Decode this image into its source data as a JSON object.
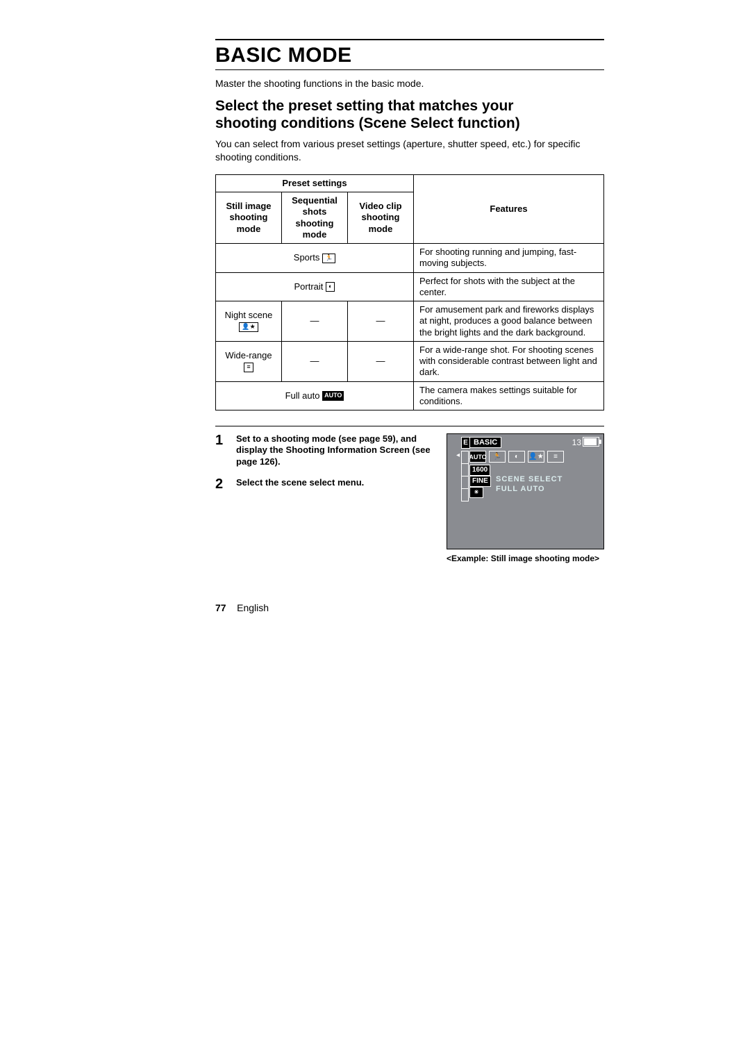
{
  "title": "BASIC MODE",
  "intro": "Master the shooting functions in the basic mode.",
  "section_title_l1": "Select the preset setting that matches your",
  "section_title_l2": "shooting conditions (Scene Select function)",
  "section_desc": "You can select from various preset settings (aperture, shutter speed, etc.) for specific shooting conditions.",
  "table": {
    "preset_head": "Preset settings",
    "col_still": "Still image shooting mode",
    "col_seq": "Sequential shots shooting mode",
    "col_video": "Video clip shooting mode",
    "col_features": "Features",
    "rows": {
      "sports": {
        "label": "Sports",
        "icon_text": "🏃",
        "span": 3,
        "feat": "For shooting running and jumping, fast-moving subjects."
      },
      "portrait": {
        "label": "Portrait",
        "icon_text": "◐",
        "span": 3,
        "feat": "Perfect for shots with the subject at the center."
      },
      "night": {
        "label": "Night scene",
        "icon_text": "👤★",
        "span": 1,
        "feat": "For amusement park and fireworks displays at night, produces a good balance between the bright lights and the dark background."
      },
      "wide": {
        "label": "Wide-range",
        "icon_text": "≡",
        "span": 1,
        "feat": "For a wide-range shot. For shooting scenes with considerable contrast between light and dark."
      },
      "auto": {
        "label": "Full auto",
        "icon_text": "AUTO",
        "span": 3,
        "feat": "The camera makes settings suitable for conditions."
      }
    },
    "dash": "—"
  },
  "steps": {
    "s1": {
      "num": "1",
      "text": "Set to a shooting mode (see page 59), and display the Shooting Information Screen (see page 126)."
    },
    "s2": {
      "num": "2",
      "text": "Select the scene select menu."
    }
  },
  "lcd": {
    "tab_e": "E",
    "tab_basic": "BASIC",
    "count": "13",
    "ico_auto": "AUTO",
    "metric_res": "1600",
    "metric_fine": "FINE",
    "label1": "SCENE SELECT",
    "label2": "FULL AUTO",
    "caption": "<Example: Still image shooting mode>"
  },
  "footer": {
    "page": "77",
    "lang": "English"
  }
}
